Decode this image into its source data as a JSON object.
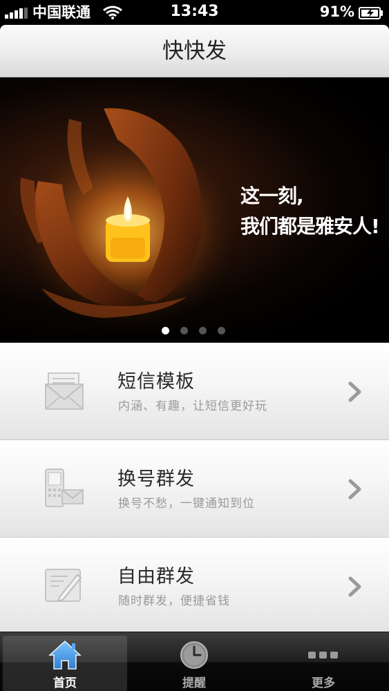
{
  "status_bar": {
    "carrier": "中国联通",
    "time": "13:43",
    "battery": "91%"
  },
  "nav": {
    "title": "快快发"
  },
  "banner": {
    "line1": "这一刻,",
    "line2": "我们都是雅安人!",
    "page_count": 4,
    "active_page": 1
  },
  "menu": {
    "items": [
      {
        "title": "短信模板",
        "subtitle": "内涵、有趣，让短信更好玩",
        "icon": "envelope-icon"
      },
      {
        "title": "换号群发",
        "subtitle": "换号不愁，一键通知到位",
        "icon": "phone-envelope-icon"
      },
      {
        "title": "自由群发",
        "subtitle": "随时群发，便捷省钱",
        "icon": "compose-icon"
      }
    ]
  },
  "tab_bar": {
    "tabs": [
      {
        "label": "首页",
        "icon": "home-icon",
        "selected": true
      },
      {
        "label": "提醒",
        "icon": "clock-icon",
        "selected": false
      },
      {
        "label": "更多",
        "icon": "more-icon",
        "selected": false
      }
    ]
  },
  "colors": {
    "tab_active_icon": "#4aa3e8",
    "banner_background": "#000000"
  }
}
